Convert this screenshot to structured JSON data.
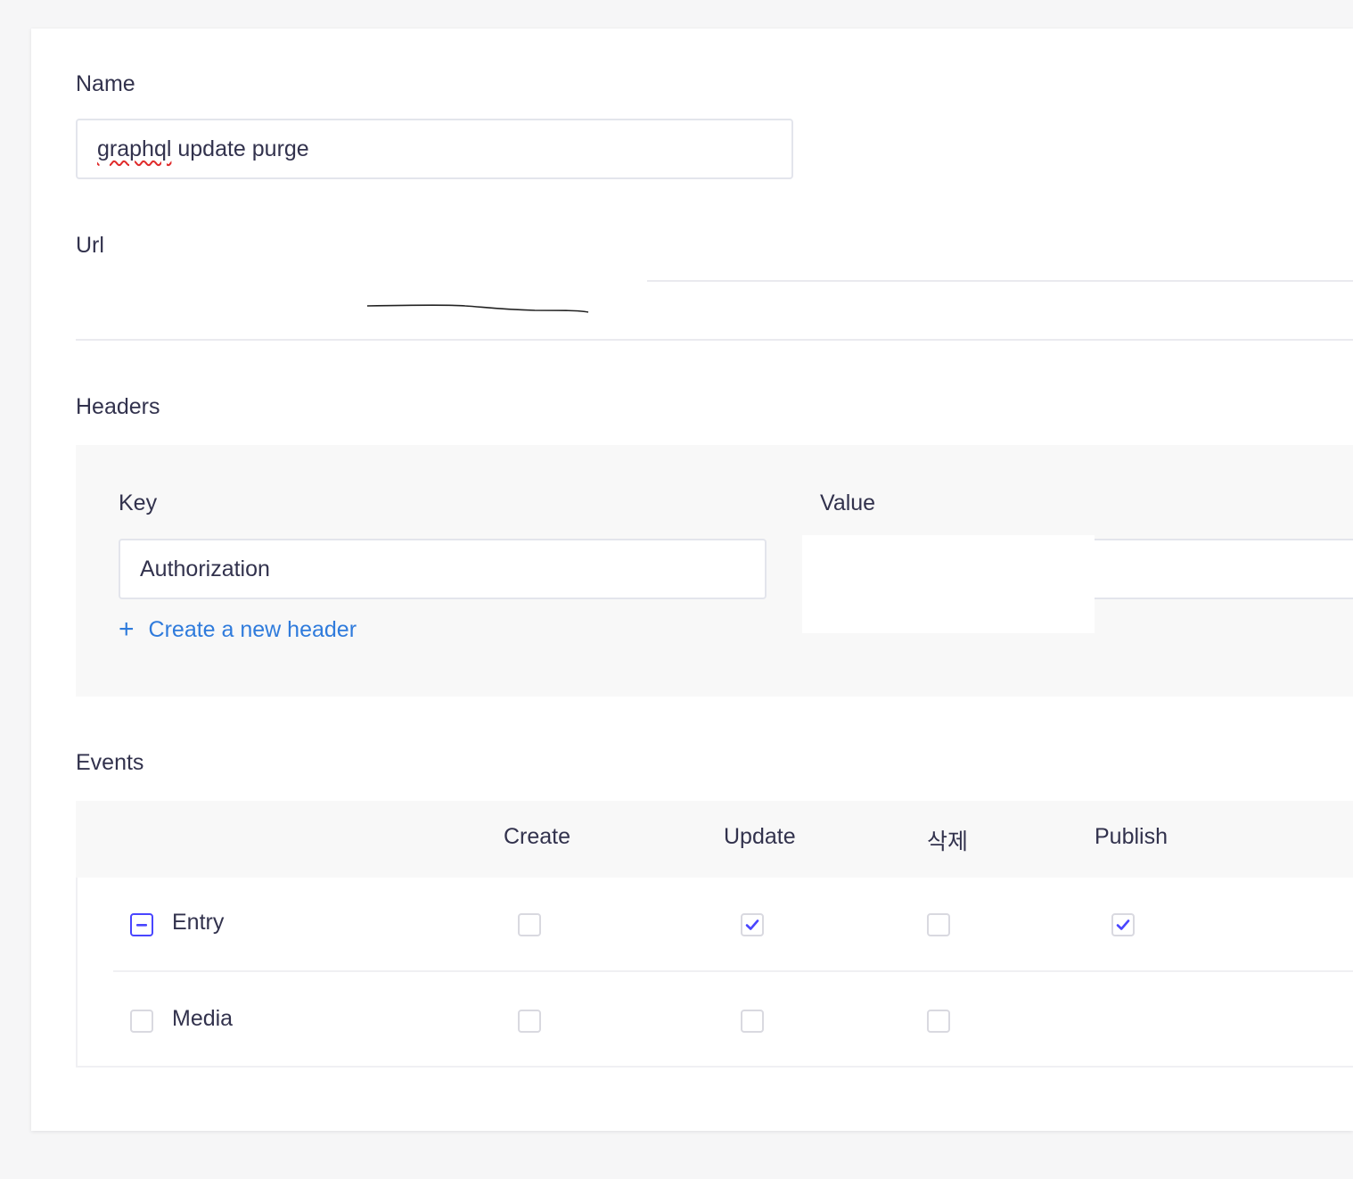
{
  "form": {
    "name": {
      "label": "Name",
      "value_misspelled": "graphql",
      "value_rest": " update purge"
    },
    "url": {
      "label": "Url"
    },
    "headers": {
      "label": "Headers",
      "key_label": "Key",
      "value_label": "Value",
      "key_value": "Authorization",
      "add_link": "Create a new header"
    },
    "events": {
      "label": "Events",
      "columns": [
        "Create",
        "Update",
        "삭제",
        "Publish"
      ],
      "rows": [
        {
          "label": "Entry",
          "row_state": "indeterminate",
          "create": false,
          "update": true,
          "delete": false,
          "publish": true
        },
        {
          "label": "Media",
          "row_state": "unchecked",
          "create": false,
          "update": false,
          "delete": false
        }
      ]
    }
  },
  "colors": {
    "accent": "#4945ff",
    "link": "#2f7bdc",
    "text": "#32324d",
    "border": "#e3e5ec",
    "panel": "#f8f8f8"
  }
}
